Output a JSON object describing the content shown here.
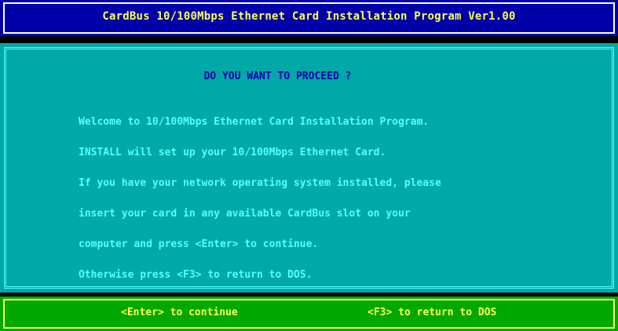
{
  "title": "CardBus 10/100Mbps Ethernet Card Installation Program Ver1.00",
  "prompt": "DO YOU WANT TO PROCEED ?",
  "message_lines": [
    "Welcome to 10/100Mbps Ethernet Card Installation Program.",
    "INSTALL will set up your 10/100Mbps Ethernet Card.",
    "If you have your network operating system installed, please",
    "insert your card in any available CardBus slot on your",
    "computer and press <Enter> to continue.",
    "Otherwise press <F3> to return to DOS."
  ],
  "footer": {
    "continue_hint": "<Enter> to continue",
    "return_hint": "<F3> to return to DOS"
  },
  "colors": {
    "title_bg": "#0000a8",
    "panel_bg": "#00a8a8",
    "footer_bg": "#00a800",
    "highlight_text": "#ffff55",
    "body_text": "#55ffff",
    "prompt_text": "#0000a8"
  }
}
